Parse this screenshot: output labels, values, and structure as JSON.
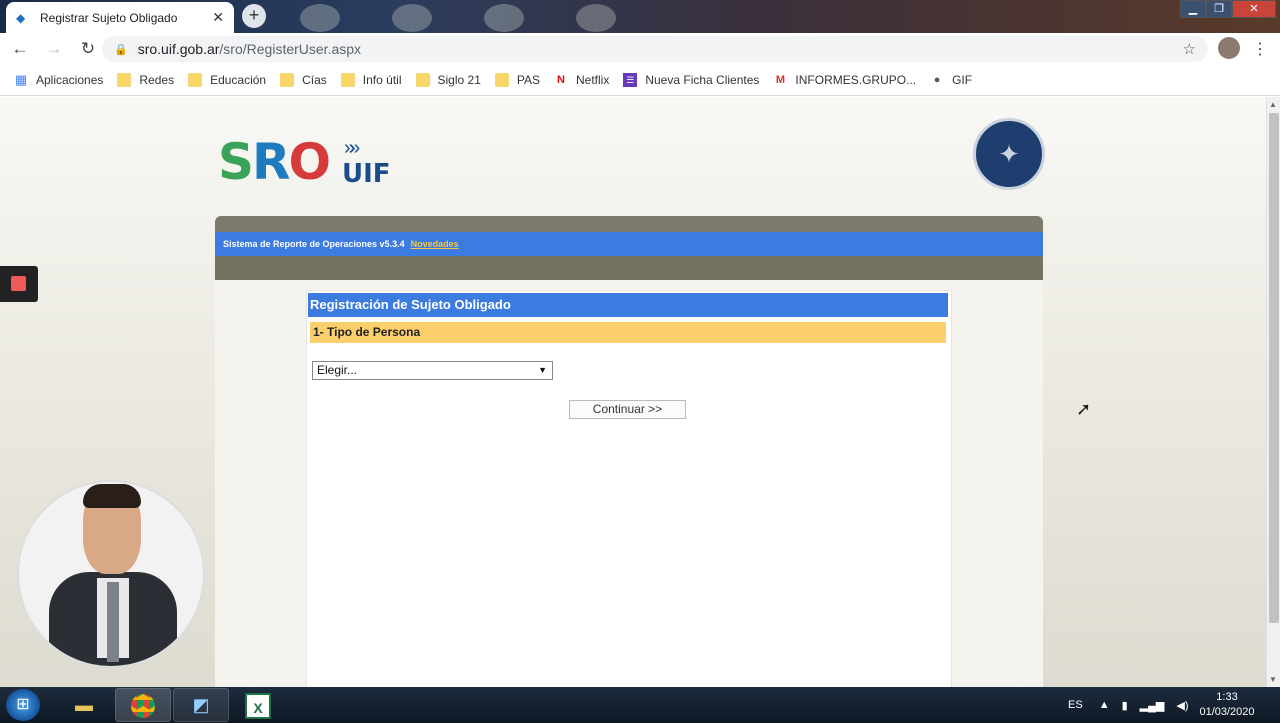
{
  "browser": {
    "tab_title": "Registrar Sujeto Obligado",
    "url_host": "sro.uif.gob.ar",
    "url_path": "/sro/RegisterUser.aspx",
    "bookmarks": [
      {
        "label": "Aplicaciones",
        "icon": "apps-grid-icon"
      },
      {
        "label": "Redes",
        "icon": "folder-icon"
      },
      {
        "label": "Educación",
        "icon": "folder-icon"
      },
      {
        "label": "Cías",
        "icon": "folder-icon"
      },
      {
        "label": "Info útil",
        "icon": "folder-icon"
      },
      {
        "label": "Siglo 21",
        "icon": "folder-icon"
      },
      {
        "label": "PAS",
        "icon": "folder-icon"
      },
      {
        "label": "Netflix",
        "icon": "netflix-icon"
      },
      {
        "label": "Nueva Ficha Clientes",
        "icon": "form-icon"
      },
      {
        "label": "INFORMES.GRUPO...",
        "icon": "gmail-icon"
      },
      {
        "label": "GIF",
        "icon": "globe-icon"
      }
    ]
  },
  "page": {
    "logo_s": "S",
    "logo_r": "R",
    "logo_o": "O",
    "logo_uif": "UIF",
    "header_text": "Sistema de Reporte de Operaciones v5.3.4",
    "header_link": "Novedades",
    "panel_title": "Registración de Sujeto Obligado",
    "step_label": "1- Tipo de Persona",
    "select_value": "Elegir...",
    "continue_label": "Continuar >>"
  },
  "taskbar": {
    "lang": "ES",
    "time": "1:33",
    "date": "01/03/2020"
  },
  "colors": {
    "header_blue": "#3c7be0",
    "step_yellow": "#fbcf6b",
    "link_yellow": "#f5c842"
  }
}
